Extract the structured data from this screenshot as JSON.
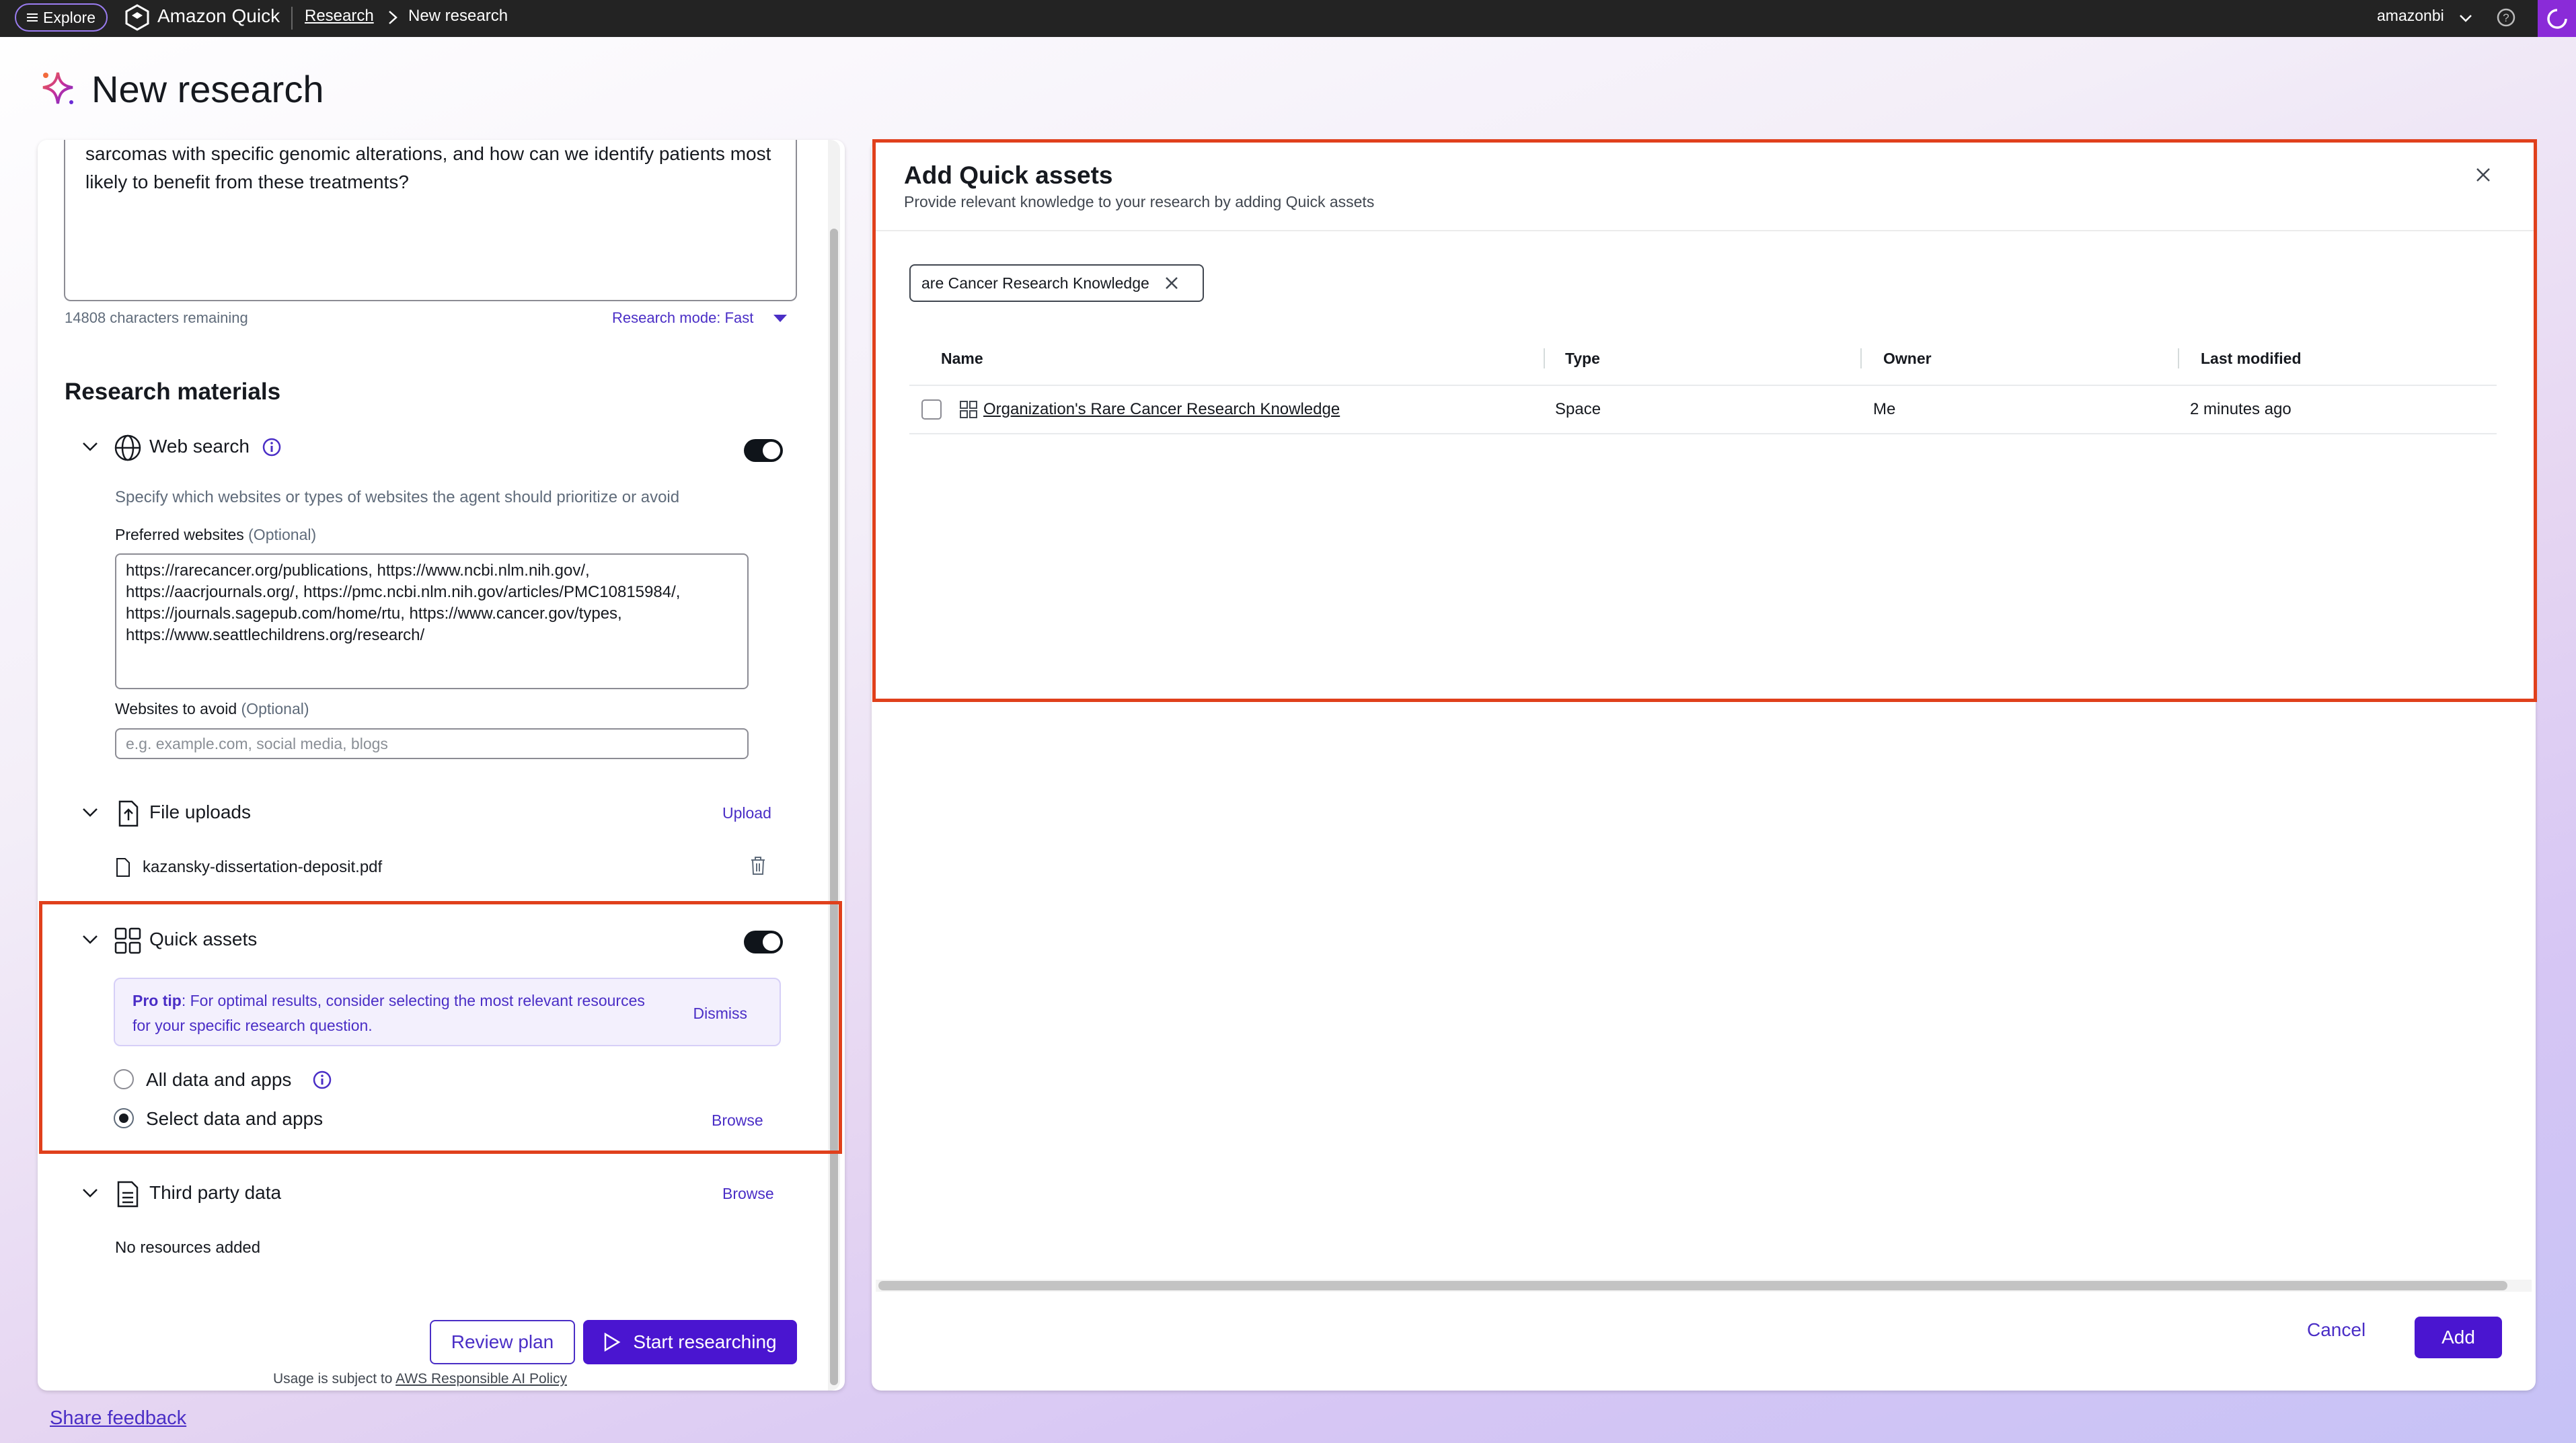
{
  "topbar": {
    "explore_label": "Explore",
    "app_name": "Amazon Quick",
    "breadcrumb_research": "Research",
    "breadcrumb_current": "New research",
    "user_name": "amazonbi"
  },
  "page": {
    "title": "New research"
  },
  "query": {
    "text": "sarcomas with specific genomic alterations, and how can we identify patients most likely to benefit from these treatments?",
    "chars_remaining": "14808 characters remaining",
    "mode_label": "Research mode: Fast"
  },
  "materials": {
    "heading": "Research materials",
    "web_search": {
      "label": "Web search",
      "description": "Specify which websites or types of websites the agent should prioritize or avoid",
      "preferred_label": "Preferred websites",
      "optional": "(Optional)",
      "preferred_value": "https://rarecancer.org/publications, https://www.ncbi.nlm.nih.gov/, https://aacrjournals.org/, https://pmc.ncbi.nlm.nih.gov/articles/PMC10815984/, https://journals.sagepub.com/home/rtu, https://www.cancer.gov/types, https://www.seattlechildrens.org/research/",
      "avoid_label": "Websites to avoid",
      "avoid_placeholder": "e.g. example.com, social media, blogs"
    },
    "file_uploads": {
      "label": "File uploads",
      "upload_label": "Upload",
      "file_name": "kazansky-dissertation-deposit.pdf"
    },
    "quick_assets": {
      "label": "Quick assets",
      "tip_strong": "Pro tip",
      "tip_text": ": For optimal results, consider selecting the most relevant resources for your specific research question.",
      "dismiss": "Dismiss",
      "option_all": "All data and apps",
      "option_select": "Select data and apps",
      "browse": "Browse"
    },
    "third_party": {
      "label": "Third party data",
      "browse": "Browse",
      "empty": "No resources added"
    }
  },
  "actions": {
    "review_plan": "Review plan",
    "start_researching": "Start researching",
    "usage_prefix": "Usage is subject to",
    "usage_link": "AWS Responsible AI Policy"
  },
  "share_feedback": "Share feedback",
  "modal": {
    "title": "Add Quick assets",
    "subtitle": "Provide relevant knowledge to your research by adding Quick assets",
    "token": "are Cancer Research Knowledge",
    "columns": {
      "name": "Name",
      "type": "Type",
      "owner": "Owner",
      "modified": "Last modified"
    },
    "rows": [
      {
        "name": "Organization's Rare Cancer Research Knowledge",
        "type": "Space",
        "owner": "Me",
        "modified": "2 minutes ago"
      }
    ],
    "cancel": "Cancel",
    "add": "Add"
  },
  "colors": {
    "accent": "#4a15d0",
    "link": "#4a2ec6",
    "highlight": "#e0401c",
    "topbar": "#232323"
  },
  "icons": [
    "menu-icon",
    "app-logo-icon",
    "chevron-right-icon",
    "chevron-down-icon",
    "help-icon",
    "sparkle-icon",
    "globe-icon",
    "info-icon",
    "file-upload-icon",
    "file-icon",
    "trash-icon",
    "grid-icon",
    "document-list-icon",
    "play-icon",
    "close-icon",
    "space-icon"
  ]
}
